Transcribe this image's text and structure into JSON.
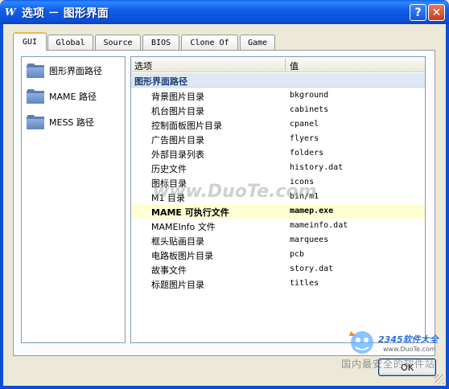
{
  "window": {
    "title": "选项 － 图形界面",
    "icon": "app-logo-icon",
    "help_label": "?",
    "close_label": "✕"
  },
  "tabs": [
    {
      "label": "GUI",
      "active": true
    },
    {
      "label": "Global",
      "active": false
    },
    {
      "label": "Source",
      "active": false
    },
    {
      "label": "BIOS",
      "active": false
    },
    {
      "label": "Clone Of",
      "active": false
    },
    {
      "label": "Game",
      "active": false
    }
  ],
  "sidebar": {
    "items": [
      {
        "label": "图形界面路径",
        "icon": "folder-icon"
      },
      {
        "label": "MAME 路径",
        "icon": "folder-icon"
      },
      {
        "label": "MESS 路径",
        "icon": "folder-icon"
      }
    ]
  },
  "table": {
    "headers": {
      "option": "选项",
      "value": "值"
    },
    "group": "图形界面路径",
    "rows": [
      {
        "key": "背景图片目录",
        "value": "bkground"
      },
      {
        "key": "机台图片目录",
        "value": "cabinets"
      },
      {
        "key": "控制面板图片目录",
        "value": "cpanel"
      },
      {
        "key": "广告图片目录",
        "value": "flyers"
      },
      {
        "key": "外部目录列表",
        "value": "folders"
      },
      {
        "key": "历史文件",
        "value": "history.dat"
      },
      {
        "key": "图标目录",
        "value": "icons"
      },
      {
        "key": "M1 目录",
        "value": "bin/m1"
      },
      {
        "key": "MAME 可执行文件",
        "value": "mamep.exe",
        "highlight": true
      },
      {
        "key": "MAMEInfo 文件",
        "value": "mameinfo.dat"
      },
      {
        "key": "框头贴画目录",
        "value": "marquees"
      },
      {
        "key": "电路板图片目录",
        "value": "pcb"
      },
      {
        "key": "故事文件",
        "value": "story.dat"
      },
      {
        "key": "标题图片目录",
        "value": "titles"
      }
    ]
  },
  "buttons": {
    "ok": "OK"
  },
  "watermarks": {
    "main": "www.DuoTe.com",
    "brand": "2345软件大全",
    "brand_url": "www.DuoTe.com",
    "bottom": "国内最安全的软件站"
  },
  "colors": {
    "titlebar": "#0a4fd6",
    "active_tab_accent": "#f7b34a",
    "group_header_bg": "#dfe8f2",
    "highlight_row": "#ffffd2",
    "close_button": "#c2401e"
  }
}
